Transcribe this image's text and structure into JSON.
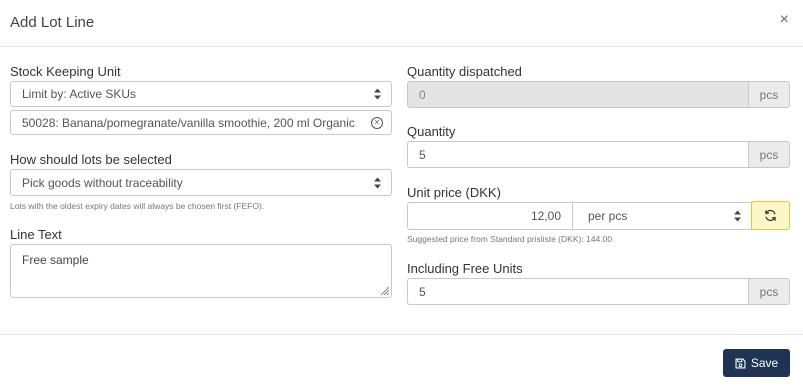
{
  "modal": {
    "title": "Add Lot Line",
    "close_glyph": "×"
  },
  "sku": {
    "label": "Stock Keeping Unit",
    "limit_select": "Limit by: Active SKUs",
    "selected_value": "50028: Banana/pomegranate/vanilla smoothie, 200 ml Organic",
    "clear_glyph": "⊗"
  },
  "lots": {
    "label": "How should lots be selected",
    "selected_value": "Pick goods without traceability",
    "help": "Lots with the oldest expiry dates will always be chosen first (FEFO)."
  },
  "line_text": {
    "label": "Line Text",
    "value": "Free sample"
  },
  "quantity_dispatched": {
    "label": "Quantity dispatched",
    "value": "0",
    "unit": "pcs"
  },
  "quantity": {
    "label": "Quantity",
    "value": "5",
    "unit": "pcs"
  },
  "unit_price": {
    "label": "Unit price (DKK)",
    "value": "12,00",
    "per_select": "per pcs",
    "help": "Suggested price from Standard prisliste (DKK): 144.00",
    "refresh_icon": "refresh-icon"
  },
  "free_units": {
    "label": "Including Free Units",
    "value": "5",
    "unit": "pcs"
  },
  "footer": {
    "save_label": "Save",
    "save_icon": "floppy-disk-icon"
  },
  "colors": {
    "save_bg": "#1f3354",
    "refresh_bg": "#fdf7c6",
    "refresh_border": "#d9c84a",
    "disabled_bg": "#e4e4e4"
  }
}
